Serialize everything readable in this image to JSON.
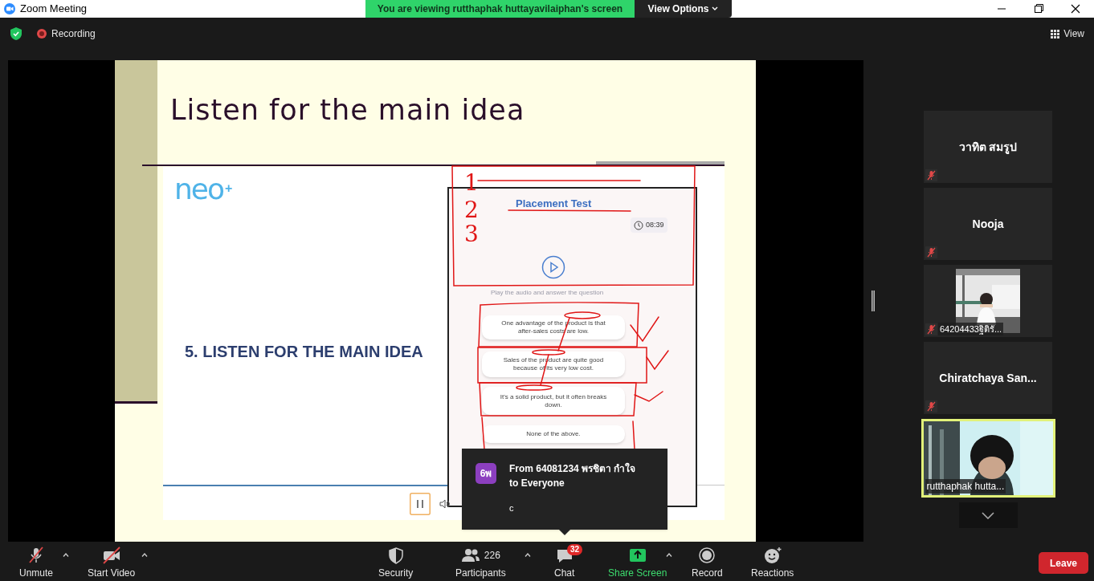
{
  "window": {
    "title": "Zoom Meeting"
  },
  "share_banner": {
    "text": "You are viewing rutthaphak huttayavilaiphan's screen",
    "view_options": "View Options"
  },
  "top_bar": {
    "recording": "Recording",
    "view": "View"
  },
  "slide": {
    "title": "Listen for the main idea",
    "heading": "5. LISTEN FOR THE MAIN IDEA",
    "logo": "neo",
    "logo_mark": "+",
    "test_title": "Placement Test",
    "timer": "08:39",
    "instruction": "Play the audio and answer the question",
    "options": [
      {
        "text": "One advantage of the product is that after-sales costs are low."
      },
      {
        "text": "Sales of the product are quite good because of its very low cost."
      },
      {
        "text": "It's a solid product, but it often breaks down."
      },
      {
        "text": "None of the above."
      }
    ],
    "annotations": [
      "1",
      "2",
      "3"
    ]
  },
  "chat_notification": {
    "avatar": "6พ",
    "sender": "From 64081234 พรชิตา กำใจ",
    "recipient": "to Everyone",
    "message": "c"
  },
  "participants": [
    {
      "name": "วาทิต สมรูป",
      "kind": "name",
      "muted": true,
      "speaking": false
    },
    {
      "name": "Nooja",
      "kind": "name",
      "muted": true,
      "speaking": false
    },
    {
      "name": "64204433ฐิติรั...",
      "muted": true,
      "speaking": false
    },
    {
      "name": "Chiratchaya  San...",
      "kind": "name",
      "muted": true,
      "speaking": false
    },
    {
      "name": "rutthaphak hutta...",
      "kind": "video",
      "muted": false,
      "speaking": true
    }
  ],
  "toolbar": [
    {
      "label": "Unmute",
      "kind": "mic",
      "menu": true
    },
    {
      "label": "Start Video",
      "kind": "video",
      "menu": true
    },
    {
      "label": "Security",
      "kind": "security",
      "menu": false
    },
    {
      "label": "Participants",
      "kind": "participants",
      "count": "226",
      "menu": true
    },
    {
      "label": "Chat",
      "kind": "chat",
      "badge": "32",
      "menu": false
    },
    {
      "label": "Share Screen",
      "kind": "share",
      "menu": true
    },
    {
      "label": "Record",
      "kind": "record",
      "menu": false
    },
    {
      "label": "Reactions",
      "kind": "reactions",
      "menu": false
    }
  ],
  "leave": "Leave"
}
